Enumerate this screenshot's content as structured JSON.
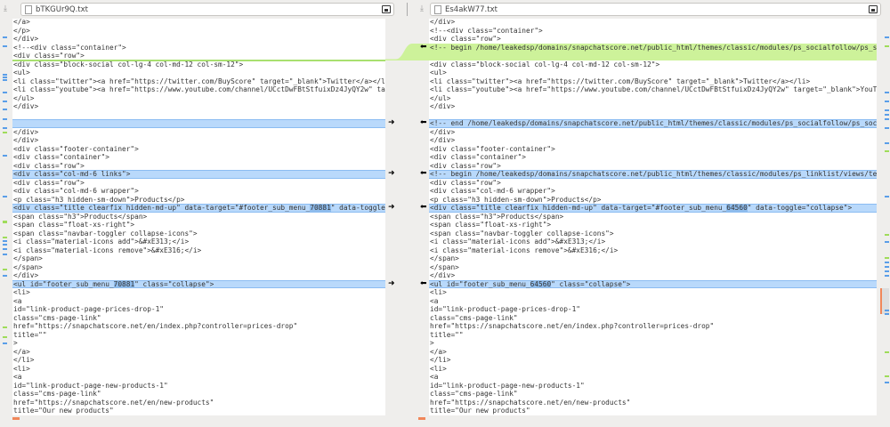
{
  "left": {
    "filename": "bTKGUr9Q.txt",
    "lines": [
      {
        "t": "</a>"
      },
      {
        "t": "</p>"
      },
      {
        "t": "</div>"
      },
      {
        "t": "<!--<div class=\"container\">"
      },
      {
        "t": "<div class=\"row\">"
      },
      {
        "t": "<div class=\"block-social col-lg-4 col-md-12 col-sm-12\">"
      },
      {
        "t": "<ul>"
      },
      {
        "t": "<li class=\"twitter\"><a href=\"https://twitter.com/BuyScore\" target=\"_blank\">Twitter</a></li>"
      },
      {
        "t": "<li class=\"youtube\"><a href=\"https://www.youtube.com/channel/UCctDwFBtStfuixDz4JyQY2w\" target=\"_blank\">YouTube</a></li>"
      },
      {
        "t": "</ul>"
      },
      {
        "t": "</div>"
      },
      {
        "t": ""
      },
      {
        "t": "",
        "k": "change"
      },
      {
        "t": "</div>"
      },
      {
        "t": "</div>"
      },
      {
        "t": "<div class=\"footer-container\">"
      },
      {
        "t": "<div class=\"container\">"
      },
      {
        "t": "<div class=\"row\">"
      },
      {
        "t": "<div class=\"col-md-6 links\">",
        "k": "change"
      },
      {
        "t": "<div class=\"row\">"
      },
      {
        "t": "<div class=\"col-md-6 wrapper\">"
      },
      {
        "t": "<p class=\"h3 hidden-sm-down\">Products</p>"
      },
      {
        "t": "<div class=\"title clearfix hidden-md-up\" data-target=\"#footer_sub_menu_",
        "hl": "70881",
        "post": "\" data-toggle=\"collapse\">",
        "k": "change"
      },
      {
        "t": "<span class=\"h3\">Products</span>"
      },
      {
        "t": "<span class=\"float-xs-right\">"
      },
      {
        "t": "<span class=\"navbar-toggler collapse-icons\">"
      },
      {
        "t": "<i class=\"material-icons add\">&#xE313;</i>"
      },
      {
        "t": "<i class=\"material-icons remove\">&#xE316;</i>"
      },
      {
        "t": "</span>"
      },
      {
        "t": "</span>"
      },
      {
        "t": "</div>"
      },
      {
        "t": "<ul id=\"footer_sub_menu_",
        "hl": "70881",
        "post": "\" class=\"collapse\">",
        "k": "change"
      },
      {
        "t": "<li>"
      },
      {
        "t": "<a"
      },
      {
        "t": "id=\"link-product-page-prices-drop-1\""
      },
      {
        "t": "class=\"cms-page-link\""
      },
      {
        "t": "href=\"https://snapchatscore.net/en/index.php?controller=prices-drop\""
      },
      {
        "t": "title=\"\""
      },
      {
        "t": ">"
      },
      {
        "t": "</a>"
      },
      {
        "t": "</li>"
      },
      {
        "t": "<li>"
      },
      {
        "t": "<a"
      },
      {
        "t": "id=\"link-product-page-new-products-1\""
      },
      {
        "t": "class=\"cms-page-link\""
      },
      {
        "t": "href=\"https://snapchatscore.net/en/new-products\""
      },
      {
        "t": "title=\"Our new products\""
      },
      {
        "t": ">"
      }
    ]
  },
  "right": {
    "filename": "Es4akW77.txt",
    "lines": [
      {
        "t": "</div>"
      },
      {
        "t": "<!--<div class=\"container\">"
      },
      {
        "t": "<div class=\"row\">"
      },
      {
        "t": "<!-- begin /home/leakedsp/domains/snapchatscore.net/public_html/themes/classic/modules/ps_socialfollow/ps_socialfollow.tpl -->",
        "k": "insert"
      },
      {
        "t": "",
        "k": "insert"
      },
      {
        "t": "<div class=\"block-social col-lg-4 col-md-12 col-sm-12\">"
      },
      {
        "t": "<ul>"
      },
      {
        "t": "<li class=\"twitter\"><a href=\"https://twitter.com/BuyScore\" target=\"_blank\">Twitter</a></li>"
      },
      {
        "t": "<li class=\"youtube\"><a href=\"https://www.youtube.com/channel/UCctDwFBtStfuixDz4JyQY2w\" target=\"_blank\">YouTube</a></li>"
      },
      {
        "t": "</ul>"
      },
      {
        "t": "</div>"
      },
      {
        "t": ""
      },
      {
        "t": "<!-- end /home/leakedsp/domains/snapchatscore.net/public_html/themes/classic/modules/ps_socialfollow/ps_socialfollow.tpl -->",
        "k": "change"
      },
      {
        "t": "</div>"
      },
      {
        "t": "</div>"
      },
      {
        "t": "<div class=\"footer-container\">"
      },
      {
        "t": "<div class=\"container\">"
      },
      {
        "t": "<div class=\"row\">"
      },
      {
        "t": "<!-- begin /home/leakedsp/domains/snapchatscore.net/public_html/themes/classic/modules/ps_linklist/views/templates/hook/linkblock.tpl -->",
        "k": "change"
      },
      {
        "t": "<div class=\"row\">"
      },
      {
        "t": "<div class=\"col-md-6 wrapper\">"
      },
      {
        "t": "<p class=\"h3 hidden-sm-down\">Products</p>"
      },
      {
        "t": "<div class=\"title clearfix hidden-md-up\" data-target=\"#footer_sub_menu_",
        "hl": "64560",
        "post": "\" data-toggle=\"collapse\">",
        "k": "change"
      },
      {
        "t": "<span class=\"h3\">Products</span>"
      },
      {
        "t": "<span class=\"float-xs-right\">"
      },
      {
        "t": "<span class=\"navbar-toggler collapse-icons\">"
      },
      {
        "t": "<i class=\"material-icons add\">&#xE313;</i>"
      },
      {
        "t": "<i class=\"material-icons remove\">&#xE316;</i>"
      },
      {
        "t": "</span>"
      },
      {
        "t": "</span>"
      },
      {
        "t": "</div>"
      },
      {
        "t": "<ul id=\"footer_sub_menu_",
        "hl": "64560",
        "post": "\" class=\"collapse\">",
        "k": "change"
      },
      {
        "t": "<li>"
      },
      {
        "t": "<a"
      },
      {
        "t": "id=\"link-product-page-prices-drop-1\""
      },
      {
        "t": "class=\"cms-page-link\""
      },
      {
        "t": "href=\"https://snapchatscore.net/en/index.php?controller=prices-drop\""
      },
      {
        "t": "title=\"\""
      },
      {
        "t": ">"
      },
      {
        "t": "</a>"
      },
      {
        "t": "</li>"
      },
      {
        "t": "<li>"
      },
      {
        "t": "<a"
      },
      {
        "t": "id=\"link-product-page-new-products-1\""
      },
      {
        "t": "class=\"cms-page-link\""
      },
      {
        "t": "href=\"https://snapchatscore.net/en/new-products\""
      },
      {
        "t": "title=\"Our new products\""
      },
      {
        "t": ">"
      }
    ]
  },
  "colors": {
    "change": "#b9d9fb",
    "insert": "#cdf29a",
    "conflict": "#f0875a"
  }
}
